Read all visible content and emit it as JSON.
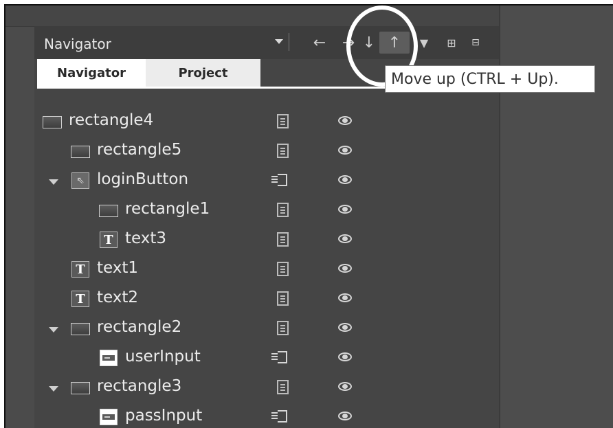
{
  "panel": {
    "title": "Navigator",
    "toolbar": {
      "move_left_glyph": "←",
      "move_right_glyph": "→",
      "move_down_glyph": "↓",
      "move_up_glyph": "↑",
      "filter_glyph": "▼",
      "add_column_glyph": "⊞",
      "collapse_glyph": "⊟"
    },
    "tabs": [
      {
        "label": "Navigator",
        "active": true
      },
      {
        "label": "Project",
        "active": false
      }
    ]
  },
  "tooltip": {
    "text": "Move up (CTRL + Up)."
  },
  "tree": {
    "rows": [
      {
        "label": "rectangle4",
        "icon": "rectangle-icon",
        "has_script": false,
        "expanded": false
      },
      {
        "label": "rectangle5",
        "icon": "rectangle-icon",
        "has_script": false,
        "expanded": false
      },
      {
        "label": "loginButton",
        "icon": "button-icon",
        "has_script": true,
        "expanded": true
      },
      {
        "label": "rectangle1",
        "icon": "rectangle-icon",
        "has_script": false,
        "expanded": false
      },
      {
        "label": "text3",
        "icon": "text-icon",
        "has_script": false,
        "expanded": false
      },
      {
        "label": "text1",
        "icon": "text-icon",
        "has_script": false,
        "expanded": false
      },
      {
        "label": "text2",
        "icon": "text-icon",
        "has_script": false,
        "expanded": false
      },
      {
        "label": "rectangle2",
        "icon": "rectangle-icon",
        "has_script": false,
        "expanded": true
      },
      {
        "label": "userInput",
        "icon": "textinput-icon",
        "has_script": true,
        "expanded": false
      },
      {
        "label": "rectangle3",
        "icon": "rectangle-icon",
        "has_script": false,
        "expanded": true
      },
      {
        "label": "passInput",
        "icon": "textinput-icon",
        "has_script": true,
        "expanded": false
      }
    ],
    "text_icon_glyph": "T",
    "button_icon_glyph": "⇖"
  }
}
